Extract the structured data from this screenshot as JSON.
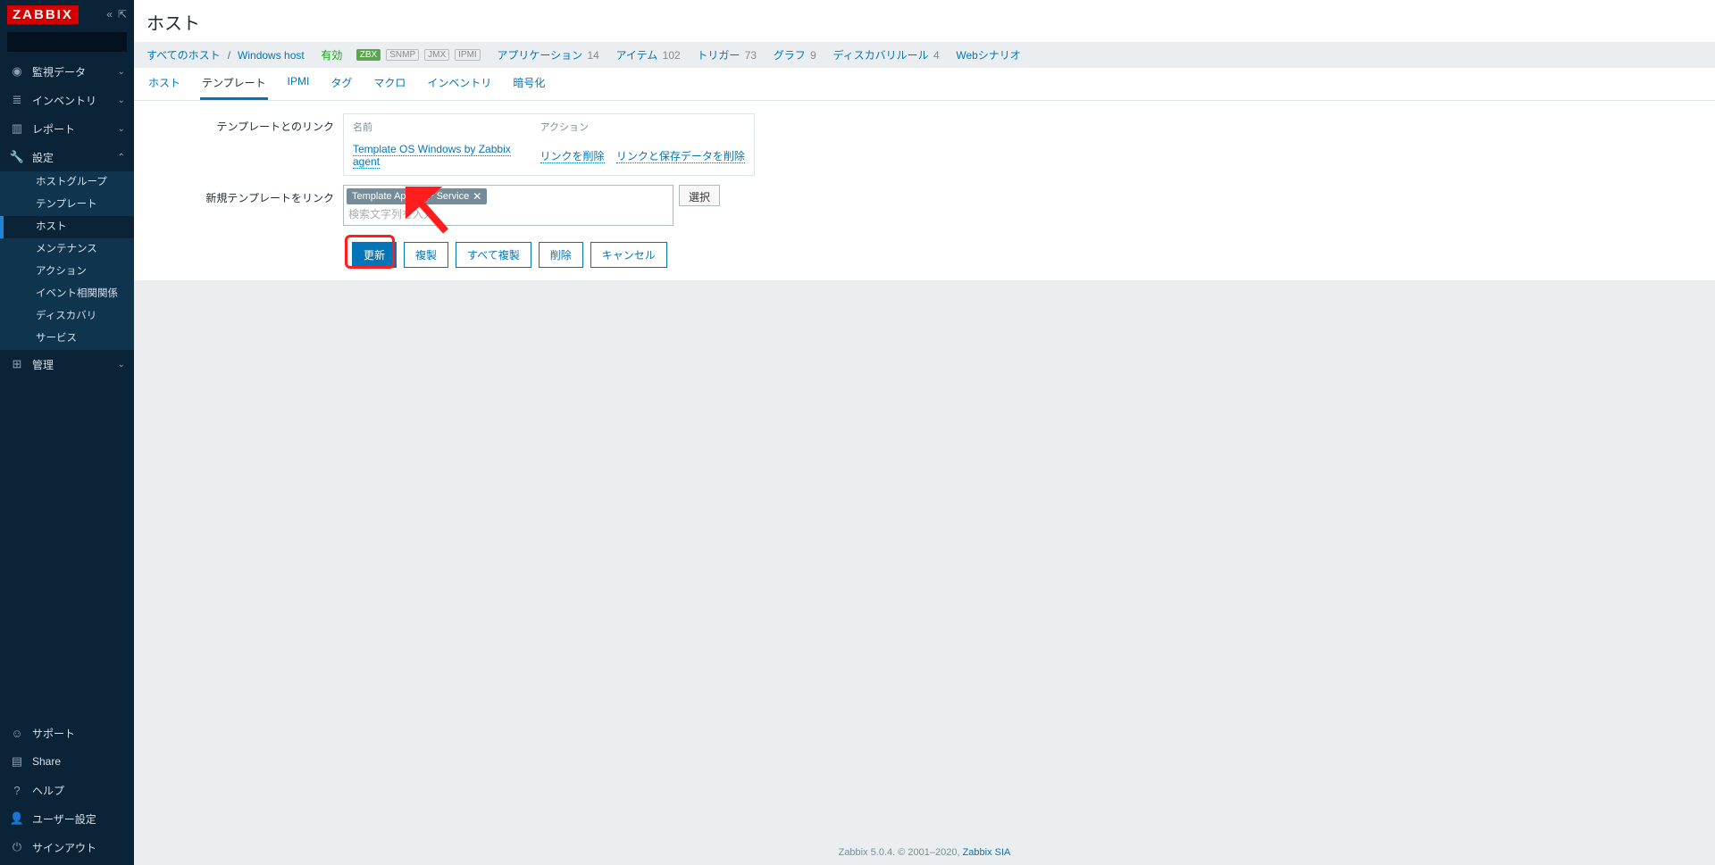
{
  "brand": "ZABBIX",
  "search": {
    "placeholder": ""
  },
  "sidebar": {
    "top": [
      {
        "icon": "◉",
        "label": "監視データ",
        "chevron": "⌄"
      },
      {
        "icon": "≣",
        "label": "インベントリ",
        "chevron": "⌄"
      },
      {
        "icon": "▥",
        "label": "レポート",
        "chevron": "⌄"
      },
      {
        "icon": "🔧",
        "label": "設定",
        "chevron": "⌃"
      }
    ],
    "settings_sub": [
      "ホストグループ",
      "テンプレート",
      "ホスト",
      "メンテナンス",
      "アクション",
      "イベント相関関係",
      "ディスカバリ",
      "サービス"
    ],
    "admin": {
      "icon": "⊞",
      "label": "管理",
      "chevron": "⌄"
    },
    "bottom": [
      {
        "icon": "☺",
        "label": "サポート"
      },
      {
        "icon": "▤",
        "label": "Share"
      },
      {
        "icon": "?",
        "label": "ヘルプ"
      },
      {
        "icon": "👤",
        "label": "ユーザー設定"
      },
      {
        "icon": "⏻",
        "label": "サインアウト"
      }
    ]
  },
  "page_title": "ホスト",
  "breadcrumb": {
    "all_hosts": "すべてのホスト",
    "host_name": "Windows host",
    "status": "有効",
    "badges": [
      "ZBX",
      "SNMP",
      "JMX",
      "IPMI"
    ],
    "items": [
      {
        "label": "アプリケーション",
        "count": "14"
      },
      {
        "label": "アイテム",
        "count": "102"
      },
      {
        "label": "トリガー",
        "count": "73"
      },
      {
        "label": "グラフ",
        "count": "9"
      },
      {
        "label": "ディスカバリルール",
        "count": "4"
      },
      {
        "label": "Webシナリオ",
        "count": ""
      }
    ]
  },
  "tabs": [
    "ホスト",
    "テンプレート",
    "IPMI",
    "タグ",
    "マクロ",
    "インベントリ",
    "暗号化"
  ],
  "form": {
    "linked_label": "テンプレートとのリンク",
    "name_header": "名前",
    "action_header": "アクション",
    "linked_template": "Template OS Windows by Zabbix agent",
    "unlink": "リンクを削除",
    "unlink_clear": "リンクと保存データを削除",
    "new_link_label": "新規テンプレートをリンク",
    "ms_tag": "Template App NTP Service",
    "ms_placeholder": "検索文字列を入力",
    "select_btn": "選択"
  },
  "buttons": {
    "update": "更新",
    "clone": "複製",
    "full_clone": "すべて複製",
    "delete": "削除",
    "cancel": "キャンセル"
  },
  "footer": {
    "text": "Zabbix 5.0.4. © 2001–2020, ",
    "link": "Zabbix SIA"
  }
}
